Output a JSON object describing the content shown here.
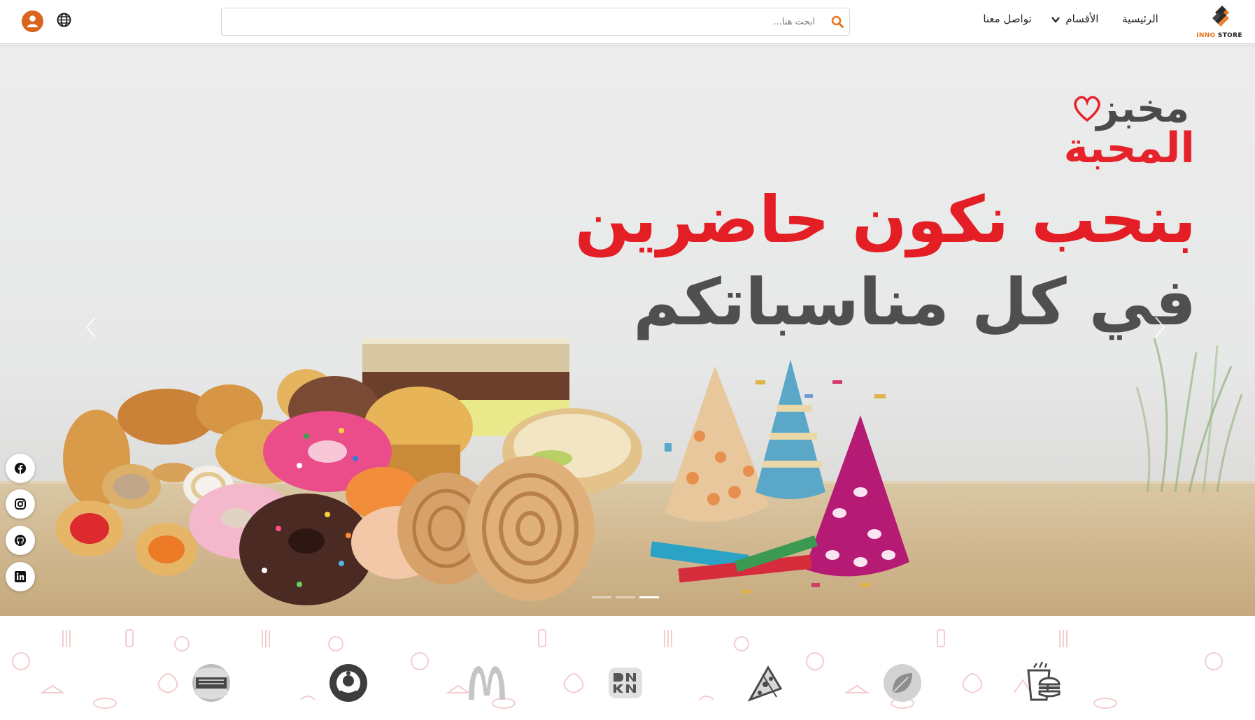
{
  "header": {
    "logo": {
      "text_main": "INNO",
      "text_accent": "STORE"
    },
    "nav": {
      "home": "الرئيسية",
      "categories": "الأقسام",
      "contact": "تواصل معنا"
    },
    "search": {
      "placeholder": "ابحث هنا...",
      "value": ""
    },
    "icons": [
      "search-icon",
      "globe-icon",
      "user-icon",
      "chevron-down-icon"
    ]
  },
  "hero": {
    "brand_line1": "مخبز",
    "brand_line2": "المحبة",
    "headline_line1": "بنحب نكون حاضرين",
    "headline_line2": "في كل مناسباتكم",
    "carousel": {
      "slides": 3,
      "active_slide": 3
    },
    "colors": {
      "headline_red": "#e31e24",
      "headline_gray": "#4f4f4f"
    }
  },
  "social": [
    "facebook-icon",
    "instagram-icon",
    "github-icon",
    "linkedin-icon"
  ],
  "brands": [
    "burger-king-logo",
    "starbucks-logo",
    "mcdonalds-logo",
    "dunkin-logo",
    "pizza-logo",
    "leaf-logo",
    "burger-fries-logo"
  ],
  "colors": {
    "accent": "#d9651e"
  }
}
